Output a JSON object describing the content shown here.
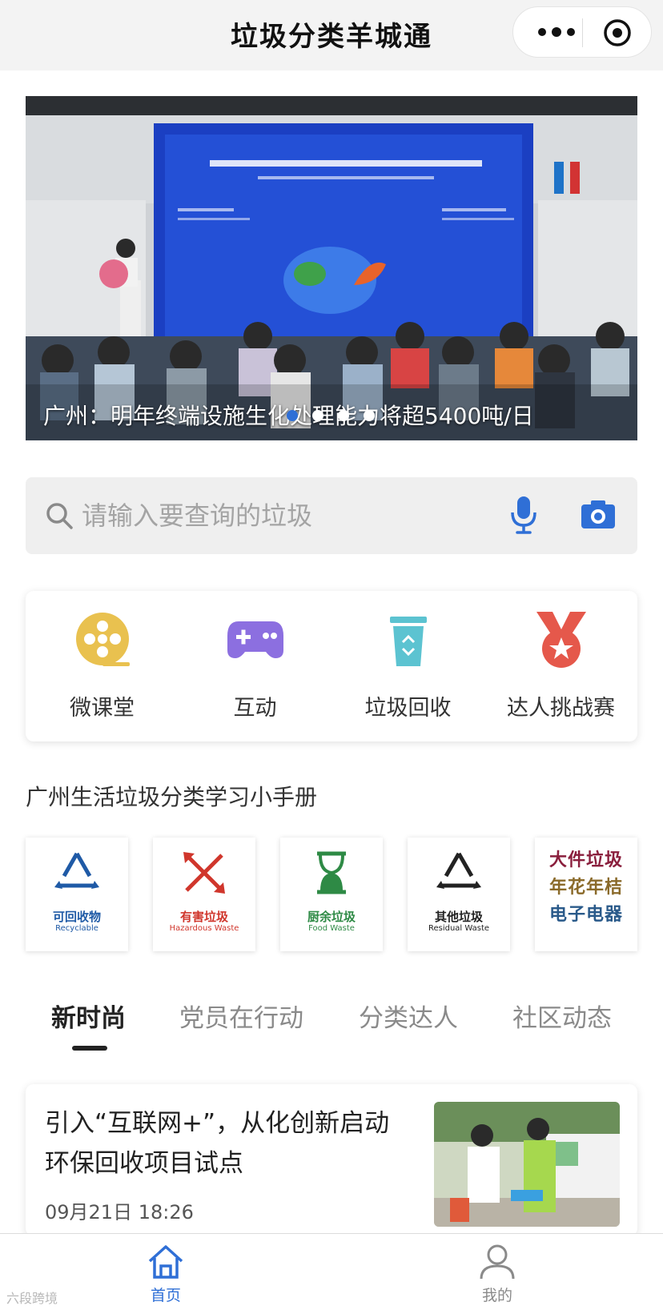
{
  "header": {
    "title": "垃圾分类羊城通",
    "more_icon": "more-dots-icon",
    "close_icon": "target-close-icon"
  },
  "banner": {
    "caption": "广州：明年终端设施生化处理能力将超5400吨/日",
    "slides": 4,
    "active_slide": 1
  },
  "search": {
    "placeholder": "请输入要查询的垃圾",
    "voice_icon": "microphone-icon",
    "camera_icon": "camera-icon"
  },
  "quick_menu": [
    {
      "label": "微课堂",
      "icon": "film-reel-icon",
      "color": "#e9c14f"
    },
    {
      "label": "互动",
      "icon": "gamepad-icon",
      "color": "#8c6fe0"
    },
    {
      "label": "垃圾回收",
      "icon": "recycle-bin-icon",
      "color": "#5cc3d1"
    },
    {
      "label": "达人挑战赛",
      "icon": "medal-icon",
      "color": "#e5584b"
    }
  ],
  "handbook": {
    "title": "广州生活垃圾分类学习小手册",
    "cards": [
      {
        "cn": "可回收物",
        "en": "Recyclable",
        "color": "#1f5aa6",
        "icon": "recycle-icon"
      },
      {
        "cn": "有害垃圾",
        "en": "Hazardous Waste",
        "color": "#d0362c",
        "icon": "hazard-arrows-icon"
      },
      {
        "cn": "厨余垃圾",
        "en": "Food Waste",
        "color": "#2e8a45",
        "icon": "hourglass-icon"
      },
      {
        "cn": "其他垃圾",
        "en": "Residual Waste",
        "color": "#222222",
        "icon": "residual-recycle-icon"
      },
      {
        "lines": [
          "大件垃圾",
          "年花年桔",
          "电子电器"
        ],
        "colors": [
          "#8a1f3d",
          "#8a6a2a",
          "#2a5a8a"
        ]
      }
    ]
  },
  "tabs": [
    {
      "label": "新时尚",
      "active": true
    },
    {
      "label": "党员在行动",
      "active": false
    },
    {
      "label": "分类达人",
      "active": false
    },
    {
      "label": "社区动态",
      "active": false
    }
  ],
  "news": [
    {
      "title": "引入“互联网+”，从化创新启动环保回收项目试点",
      "time": "09月21日 18:26"
    }
  ],
  "bottom_nav": [
    {
      "label": "首页",
      "icon": "home-icon",
      "active": true,
      "color": "#2f6fd6"
    },
    {
      "label": "我的",
      "icon": "user-icon",
      "active": false,
      "color": "#8a8a8a"
    }
  ],
  "watermark": "六段跨境"
}
